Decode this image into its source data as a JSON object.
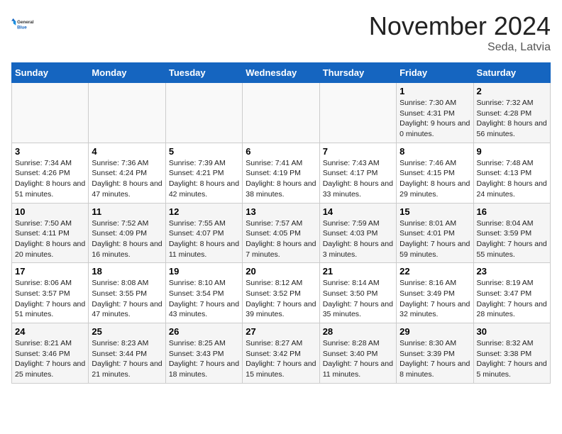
{
  "logo": {
    "general": "General",
    "blue": "Blue"
  },
  "header": {
    "month": "November 2024",
    "location": "Seda, Latvia"
  },
  "weekdays": [
    "Sunday",
    "Monday",
    "Tuesday",
    "Wednesday",
    "Thursday",
    "Friday",
    "Saturday"
  ],
  "rows": [
    [
      {
        "day": "",
        "sunrise": "",
        "sunset": "",
        "daylight": ""
      },
      {
        "day": "",
        "sunrise": "",
        "sunset": "",
        "daylight": ""
      },
      {
        "day": "",
        "sunrise": "",
        "sunset": "",
        "daylight": ""
      },
      {
        "day": "",
        "sunrise": "",
        "sunset": "",
        "daylight": ""
      },
      {
        "day": "",
        "sunrise": "",
        "sunset": "",
        "daylight": ""
      },
      {
        "day": "1",
        "sunrise": "Sunrise: 7:30 AM",
        "sunset": "Sunset: 4:31 PM",
        "daylight": "Daylight: 9 hours and 0 minutes."
      },
      {
        "day": "2",
        "sunrise": "Sunrise: 7:32 AM",
        "sunset": "Sunset: 4:28 PM",
        "daylight": "Daylight: 8 hours and 56 minutes."
      }
    ],
    [
      {
        "day": "3",
        "sunrise": "Sunrise: 7:34 AM",
        "sunset": "Sunset: 4:26 PM",
        "daylight": "Daylight: 8 hours and 51 minutes."
      },
      {
        "day": "4",
        "sunrise": "Sunrise: 7:36 AM",
        "sunset": "Sunset: 4:24 PM",
        "daylight": "Daylight: 8 hours and 47 minutes."
      },
      {
        "day": "5",
        "sunrise": "Sunrise: 7:39 AM",
        "sunset": "Sunset: 4:21 PM",
        "daylight": "Daylight: 8 hours and 42 minutes."
      },
      {
        "day": "6",
        "sunrise": "Sunrise: 7:41 AM",
        "sunset": "Sunset: 4:19 PM",
        "daylight": "Daylight: 8 hours and 38 minutes."
      },
      {
        "day": "7",
        "sunrise": "Sunrise: 7:43 AM",
        "sunset": "Sunset: 4:17 PM",
        "daylight": "Daylight: 8 hours and 33 minutes."
      },
      {
        "day": "8",
        "sunrise": "Sunrise: 7:46 AM",
        "sunset": "Sunset: 4:15 PM",
        "daylight": "Daylight: 8 hours and 29 minutes."
      },
      {
        "day": "9",
        "sunrise": "Sunrise: 7:48 AM",
        "sunset": "Sunset: 4:13 PM",
        "daylight": "Daylight: 8 hours and 24 minutes."
      }
    ],
    [
      {
        "day": "10",
        "sunrise": "Sunrise: 7:50 AM",
        "sunset": "Sunset: 4:11 PM",
        "daylight": "Daylight: 8 hours and 20 minutes."
      },
      {
        "day": "11",
        "sunrise": "Sunrise: 7:52 AM",
        "sunset": "Sunset: 4:09 PM",
        "daylight": "Daylight: 8 hours and 16 minutes."
      },
      {
        "day": "12",
        "sunrise": "Sunrise: 7:55 AM",
        "sunset": "Sunset: 4:07 PM",
        "daylight": "Daylight: 8 hours and 11 minutes."
      },
      {
        "day": "13",
        "sunrise": "Sunrise: 7:57 AM",
        "sunset": "Sunset: 4:05 PM",
        "daylight": "Daylight: 8 hours and 7 minutes."
      },
      {
        "day": "14",
        "sunrise": "Sunrise: 7:59 AM",
        "sunset": "Sunset: 4:03 PM",
        "daylight": "Daylight: 8 hours and 3 minutes."
      },
      {
        "day": "15",
        "sunrise": "Sunrise: 8:01 AM",
        "sunset": "Sunset: 4:01 PM",
        "daylight": "Daylight: 7 hours and 59 minutes."
      },
      {
        "day": "16",
        "sunrise": "Sunrise: 8:04 AM",
        "sunset": "Sunset: 3:59 PM",
        "daylight": "Daylight: 7 hours and 55 minutes."
      }
    ],
    [
      {
        "day": "17",
        "sunrise": "Sunrise: 8:06 AM",
        "sunset": "Sunset: 3:57 PM",
        "daylight": "Daylight: 7 hours and 51 minutes."
      },
      {
        "day": "18",
        "sunrise": "Sunrise: 8:08 AM",
        "sunset": "Sunset: 3:55 PM",
        "daylight": "Daylight: 7 hours and 47 minutes."
      },
      {
        "day": "19",
        "sunrise": "Sunrise: 8:10 AM",
        "sunset": "Sunset: 3:54 PM",
        "daylight": "Daylight: 7 hours and 43 minutes."
      },
      {
        "day": "20",
        "sunrise": "Sunrise: 8:12 AM",
        "sunset": "Sunset: 3:52 PM",
        "daylight": "Daylight: 7 hours and 39 minutes."
      },
      {
        "day": "21",
        "sunrise": "Sunrise: 8:14 AM",
        "sunset": "Sunset: 3:50 PM",
        "daylight": "Daylight: 7 hours and 35 minutes."
      },
      {
        "day": "22",
        "sunrise": "Sunrise: 8:16 AM",
        "sunset": "Sunset: 3:49 PM",
        "daylight": "Daylight: 7 hours and 32 minutes."
      },
      {
        "day": "23",
        "sunrise": "Sunrise: 8:19 AM",
        "sunset": "Sunset: 3:47 PM",
        "daylight": "Daylight: 7 hours and 28 minutes."
      }
    ],
    [
      {
        "day": "24",
        "sunrise": "Sunrise: 8:21 AM",
        "sunset": "Sunset: 3:46 PM",
        "daylight": "Daylight: 7 hours and 25 minutes."
      },
      {
        "day": "25",
        "sunrise": "Sunrise: 8:23 AM",
        "sunset": "Sunset: 3:44 PM",
        "daylight": "Daylight: 7 hours and 21 minutes."
      },
      {
        "day": "26",
        "sunrise": "Sunrise: 8:25 AM",
        "sunset": "Sunset: 3:43 PM",
        "daylight": "Daylight: 7 hours and 18 minutes."
      },
      {
        "day": "27",
        "sunrise": "Sunrise: 8:27 AM",
        "sunset": "Sunset: 3:42 PM",
        "daylight": "Daylight: 7 hours and 15 minutes."
      },
      {
        "day": "28",
        "sunrise": "Sunrise: 8:28 AM",
        "sunset": "Sunset: 3:40 PM",
        "daylight": "Daylight: 7 hours and 11 minutes."
      },
      {
        "day": "29",
        "sunrise": "Sunrise: 8:30 AM",
        "sunset": "Sunset: 3:39 PM",
        "daylight": "Daylight: 7 hours and 8 minutes."
      },
      {
        "day": "30",
        "sunrise": "Sunrise: 8:32 AM",
        "sunset": "Sunset: 3:38 PM",
        "daylight": "Daylight: 7 hours and 5 minutes."
      }
    ]
  ]
}
